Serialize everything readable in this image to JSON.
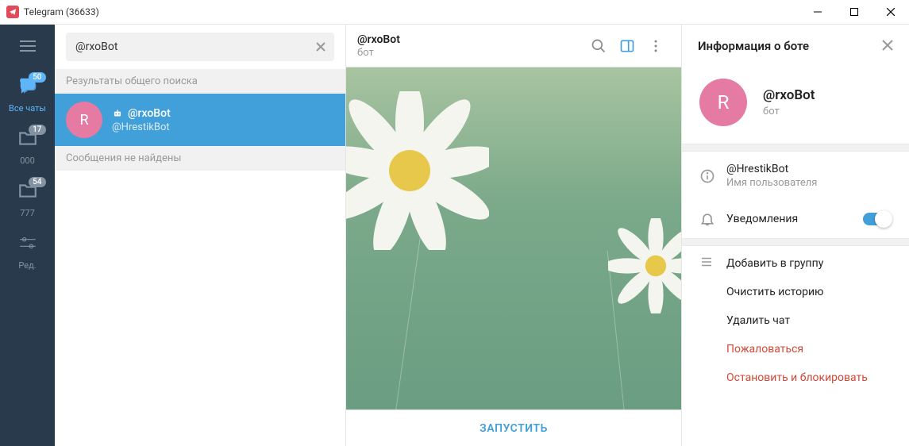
{
  "window": {
    "title": "Telegram (36633)"
  },
  "rail": {
    "folders": [
      {
        "label": "Все чаты",
        "badge": "50"
      },
      {
        "label": "000",
        "badge": "17"
      },
      {
        "label": "777",
        "badge": "54"
      },
      {
        "label": "Ред.",
        "badge": ""
      }
    ]
  },
  "search": {
    "value": "@rxoBot",
    "section_global": "Результаты общего поиска",
    "section_nomsg": "Сообщения не найдены",
    "result": {
      "avatar_letter": "R",
      "title": "@rxoBot",
      "subtitle": "@HrestikBot"
    }
  },
  "chat": {
    "title": "@rxoBot",
    "subtitle": "бот",
    "start": "ЗАПУСТИТЬ"
  },
  "info": {
    "header": "Информация о боте",
    "avatar_letter": "R",
    "name": "@rxoBot",
    "sub": "бот",
    "username": "@HrestikBot",
    "username_label": "Имя пользователя",
    "notifications": "Уведомления",
    "notifications_on": true,
    "actions": {
      "add_group": "Добавить в группу",
      "clear_history": "Очистить историю",
      "delete_chat": "Удалить чат",
      "report": "Пожаловаться",
      "stop_block": "Остановить и блокировать"
    }
  }
}
